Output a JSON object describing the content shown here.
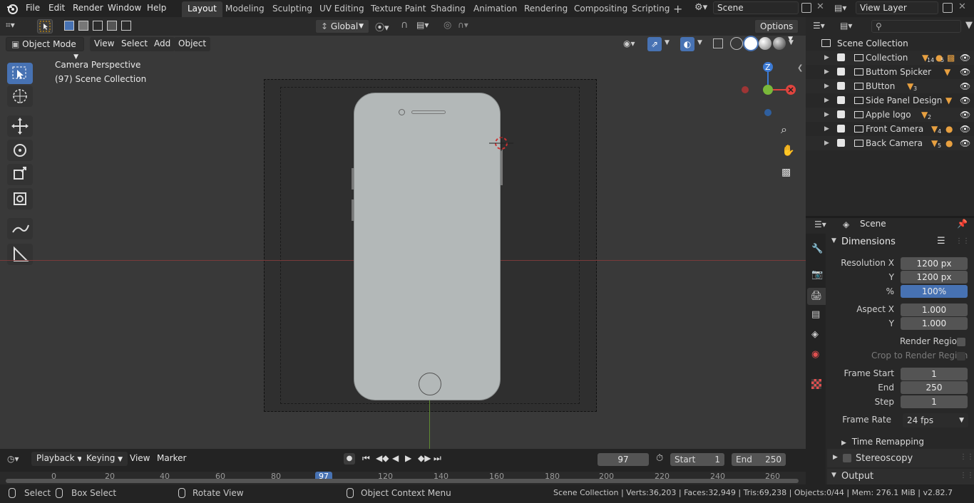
{
  "topbar": {
    "menus": [
      "File",
      "Edit",
      "Render",
      "Window",
      "Help"
    ],
    "workspaces": [
      "Layout",
      "Modeling",
      "Sculpting",
      "UV Editing",
      "Texture Paint",
      "Shading",
      "Animation",
      "Rendering",
      "Compositing",
      "Scripting"
    ],
    "scene": "Scene",
    "view_layer": "View Layer"
  },
  "viewport": {
    "orientation": "Global",
    "options": "Options",
    "mode": "Object Mode",
    "menus": [
      "View",
      "Select",
      "Add",
      "Object"
    ],
    "overlay_title": "Camera Perspective",
    "overlay_collection": "(97) Scene Collection",
    "gizmo": {
      "z": "Z"
    }
  },
  "outliner": {
    "root": "Scene Collection",
    "items": [
      {
        "name": "Collection",
        "count": "14",
        "count2": "5"
      },
      {
        "name": "Buttom Spicker",
        "count": ""
      },
      {
        "name": "BUtton",
        "count": "3"
      },
      {
        "name": "Side Panel Design",
        "count": ""
      },
      {
        "name": "Apple logo",
        "count": "2"
      },
      {
        "name": "Front Camera",
        "count": "4"
      },
      {
        "name": "Back Camera",
        "count": "5"
      }
    ]
  },
  "properties": {
    "context": "Scene",
    "panel_dimensions": "Dimensions",
    "resolution_x_label": "Resolution X",
    "resolution_x": "1200 px",
    "resolution_y_label": "Y",
    "resolution_y": "1200 px",
    "percent_label": "%",
    "percent": "100%",
    "aspect_x_label": "Aspect X",
    "aspect_x": "1.000",
    "aspect_y_label": "Y",
    "aspect_y": "1.000",
    "render_region": "Render Region",
    "crop_region": "Crop to Render Region",
    "frame_start_label": "Frame Start",
    "frame_start": "1",
    "end_label": "End",
    "end": "250",
    "step_label": "Step",
    "step": "1",
    "frame_rate_label": "Frame Rate",
    "frame_rate": "24 fps",
    "time_remapping": "Time Remapping",
    "stereoscopy": "Stereoscopy",
    "output": "Output"
  },
  "timeline": {
    "menus": [
      "Playback",
      "Keying",
      "View",
      "Marker"
    ],
    "current_frame": "97",
    "start_label": "Start",
    "start": "1",
    "end_label": "End",
    "end": "250",
    "ticks": [
      "0",
      "20",
      "40",
      "60",
      "80",
      "97",
      "120",
      "140",
      "160",
      "180",
      "200",
      "220",
      "240",
      "260"
    ]
  },
  "statusbar": {
    "select": "Select",
    "box_select": "Box Select",
    "rotate_view": "Rotate View",
    "context_menu": "Object Context Menu",
    "stats": "Scene Collection | Verts:36,203 | Faces:32,949 | Tris:69,238 | Objects:0/44 | Mem: 276.1 MiB | v2.82.7"
  },
  "colors": {
    "accent": "#4772b3",
    "x_axis": "#e0443e",
    "y_axis": "#7ab83a",
    "z_axis": "#3c7ad4"
  }
}
